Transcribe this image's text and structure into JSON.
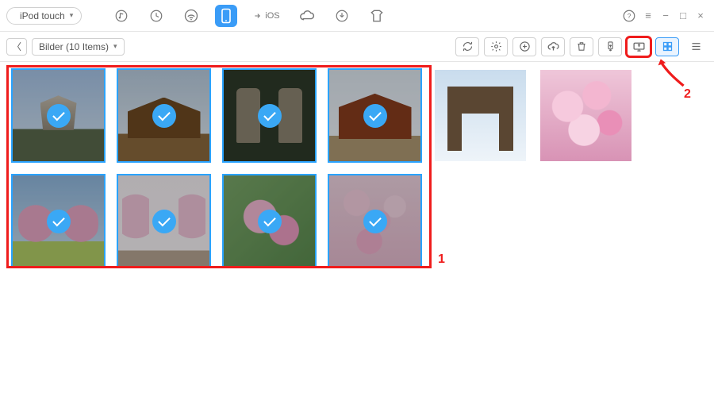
{
  "device": {
    "name": "iPod touch"
  },
  "top_icons": {
    "music": "music-icon",
    "history": "history-icon",
    "wifi": "wifi-icon",
    "device": "device-icon",
    "ios": "to-ios-icon",
    "ios_text": "iOS",
    "cloud": "cloud-icon",
    "download": "download-icon",
    "tshirt": "skin-icon"
  },
  "window": {
    "help": "?",
    "menu": "≡",
    "min": "−",
    "max": "□",
    "close": "×"
  },
  "nav": {
    "back": "〈",
    "folder_label": "Bilder (10 Items)"
  },
  "actions": {
    "refresh": "refresh-icon",
    "settings": "settings-icon",
    "add": "add-icon",
    "upload": "cloud-upload-icon",
    "delete": "trash-icon",
    "to_device": "send-to-device-icon",
    "to_pc": "send-to-pc-icon",
    "grid": "grid-view-icon",
    "list": "list-view-icon"
  },
  "annotations": {
    "step1": "1",
    "step2": "2"
  },
  "photos": [
    {
      "name": "castle",
      "selected": true,
      "bg": "castle"
    },
    {
      "name": "temple-wide",
      "selected": true,
      "bg": "temple1"
    },
    {
      "name": "stone-lanterns",
      "selected": true,
      "bg": "lanterns"
    },
    {
      "name": "temple-red",
      "selected": true,
      "bg": "temple2"
    },
    {
      "name": "torii-gate",
      "selected": false,
      "bg": "torii"
    },
    {
      "name": "blossom-close",
      "selected": false,
      "bg": "blossom-close"
    },
    {
      "name": "orchard",
      "selected": true,
      "bg": "orchard"
    },
    {
      "name": "blossom-path",
      "selected": true,
      "bg": "path"
    },
    {
      "name": "flower-macro",
      "selected": true,
      "bg": "flower1"
    },
    {
      "name": "flower-field",
      "selected": true,
      "bg": "flower2"
    }
  ]
}
